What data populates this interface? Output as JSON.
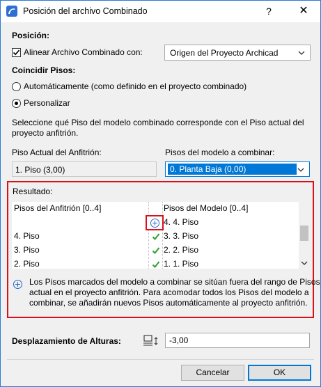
{
  "window": {
    "title": "Posición del archivo Combinado",
    "help_label": "?",
    "close_label": "✕"
  },
  "position": {
    "heading": "Posición:",
    "align_checked": true,
    "align_label": "Alinear Archivo Combinado con:",
    "align_select": "Origen del Proyecto Archicad"
  },
  "stories": {
    "heading": "Coincidir Pisos:",
    "auto_label": "Automáticamente (como definido en el proyecto combinado)",
    "custom_label": "Personalizar",
    "selected": "custom",
    "description": [
      "Seleccione qué Piso del modelo combinado corresponde con el Piso actual del",
      "proyecto anfitrión."
    ],
    "host_label": "Piso Actual del Anfitrión:",
    "host_value": "1. Piso (3,00)",
    "model_label": "Pisos del modelo a combinar:",
    "model_value": "0. Planta Baja (0,00)"
  },
  "result": {
    "heading": "Resultado:",
    "col_host": "Pisos del Anfitrión [0..4]",
    "col_model": "Pisos del Modelo [0..4]",
    "rows": [
      {
        "host": "",
        "status": "add",
        "model": "4. 4. Piso"
      },
      {
        "host": "4. Piso",
        "status": "check",
        "model": "3. 3. Piso"
      },
      {
        "host": "3. Piso",
        "status": "check",
        "model": "2. 2. Piso"
      },
      {
        "host": "2. Piso",
        "status": "check",
        "model": "1. 1. Piso"
      }
    ],
    "note": [
      "Los Pisos marcados del modelo a combinar se sitúan fuera del rango de Pisos",
      "actual en el proyecto anfitrión. Para acomodar todos los Pisos del modelo a",
      "combinar, se añadirán nuevos Pisos automáticamente al proyecto anfitrión."
    ]
  },
  "offset": {
    "label": "Desplazamiento de Alturas:",
    "value": "-3,00"
  },
  "buttons": {
    "cancel": "Cancelar",
    "ok": "OK"
  },
  "colors": {
    "highlight_red": "#d9101a",
    "select_blue": "#0078d7",
    "check_green": "#2e9e2e"
  }
}
